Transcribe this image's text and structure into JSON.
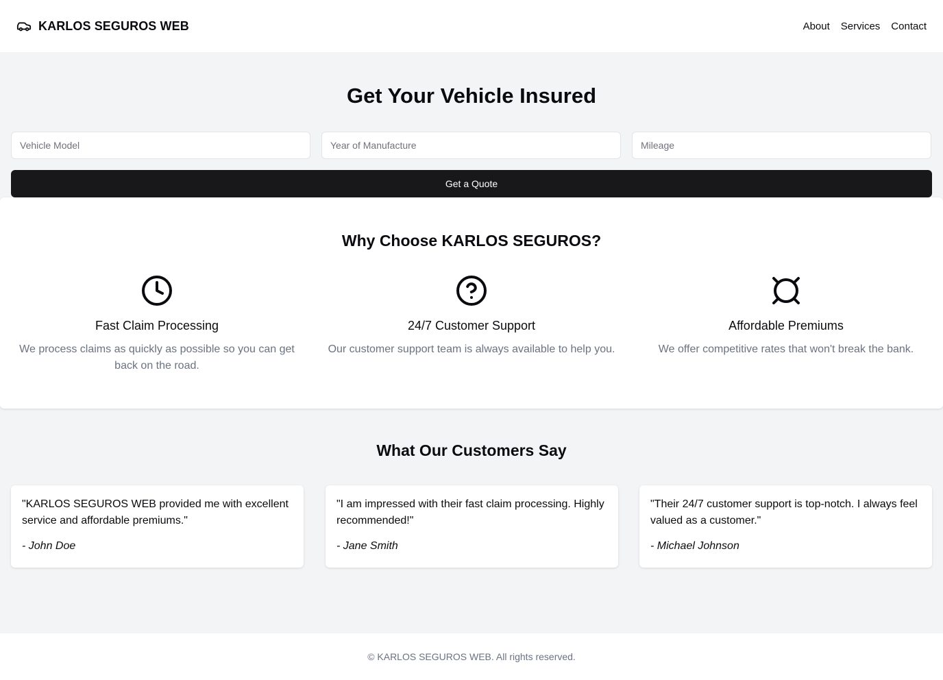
{
  "header": {
    "brand_name": "KARLOS SEGUROS WEB",
    "brand_icon": "car-icon",
    "nav": [
      {
        "label": "About"
      },
      {
        "label": "Services"
      },
      {
        "label": "Contact"
      }
    ]
  },
  "hero": {
    "title": "Get Your Vehicle Insured",
    "inputs": [
      {
        "placeholder": "Vehicle Model",
        "value": ""
      },
      {
        "placeholder": "Year of Manufacture",
        "value": ""
      },
      {
        "placeholder": "Mileage",
        "value": ""
      }
    ],
    "button_label": "Get a Quote"
  },
  "features": {
    "title": "Why Choose KARLOS SEGUROS?",
    "items": [
      {
        "icon": "clock-icon",
        "title": "Fast Claim Processing",
        "description": "We process claims as quickly as possible so you can get back on the road."
      },
      {
        "icon": "help-circle-icon",
        "title": "24/7 Customer Support",
        "description": "Our customer support team is always available to help you."
      },
      {
        "icon": "currency-icon",
        "title": "Affordable Premiums",
        "description": "We offer competitive rates that won't break the bank."
      }
    ]
  },
  "testimonials": {
    "title": "What Our Customers Say",
    "items": [
      {
        "quote": "\"KARLOS SEGUROS WEB provided me with excellent service and affordable premiums.\"",
        "author": "- John Doe"
      },
      {
        "quote": "\"I am impressed with their fast claim processing. Highly recommended!\"",
        "author": "- Jane Smith"
      },
      {
        "quote": "\"Their 24/7 customer support is top-notch. I always feel valued as a customer.\"",
        "author": "- Michael Johnson"
      }
    ]
  },
  "footer": {
    "text": "© KARLOS SEGUROS WEB. All rights reserved."
  },
  "colors": {
    "page_background": "#f3f4f6",
    "surface": "#ffffff",
    "primary_button": "#18181b",
    "muted_text": "#6b7280"
  }
}
